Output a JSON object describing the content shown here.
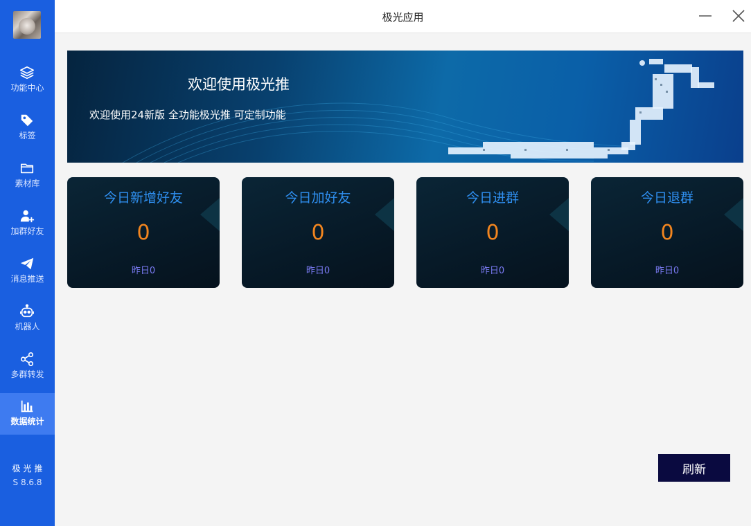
{
  "window": {
    "title": "极光应用"
  },
  "sidebar": {
    "items": [
      {
        "label": "功能中心",
        "icon": "layers-icon",
        "active": false
      },
      {
        "label": "标签",
        "icon": "tag-icon",
        "active": false
      },
      {
        "label": "素材库",
        "icon": "folder-icon",
        "active": false
      },
      {
        "label": "加群好友",
        "icon": "add-user-icon",
        "active": false
      },
      {
        "label": "消息推送",
        "icon": "send-icon",
        "active": false
      },
      {
        "label": "机器人",
        "icon": "robot-icon",
        "active": false
      },
      {
        "label": "多群转发",
        "icon": "share-icon",
        "active": false
      },
      {
        "label": "数据统计",
        "icon": "bar-chart-icon",
        "active": true
      }
    ],
    "brand": {
      "name": "极光推",
      "version": "S 8.6.8"
    }
  },
  "banner": {
    "title": "欢迎使用极光推",
    "subtitle": "欢迎使用24新版 全功能极光推 可定制功能"
  },
  "stats": [
    {
      "title": "今日新增好友",
      "value": "0",
      "footer": "昨日0"
    },
    {
      "title": "今日加好友",
      "value": "0",
      "footer": "昨日0"
    },
    {
      "title": "今日进群",
      "value": "0",
      "footer": "昨日0"
    },
    {
      "title": "今日退群",
      "value": "0",
      "footer": "昨日0"
    }
  ],
  "actions": {
    "refresh_label": "刷新"
  },
  "colors": {
    "sidebar": "#1a5fe0",
    "sidebar_active": "#3e7bf0",
    "card_title": "#2f8ff0",
    "card_value": "#f2851f",
    "card_footer": "#7b7bf4",
    "refresh_button": "#0a0a40"
  }
}
